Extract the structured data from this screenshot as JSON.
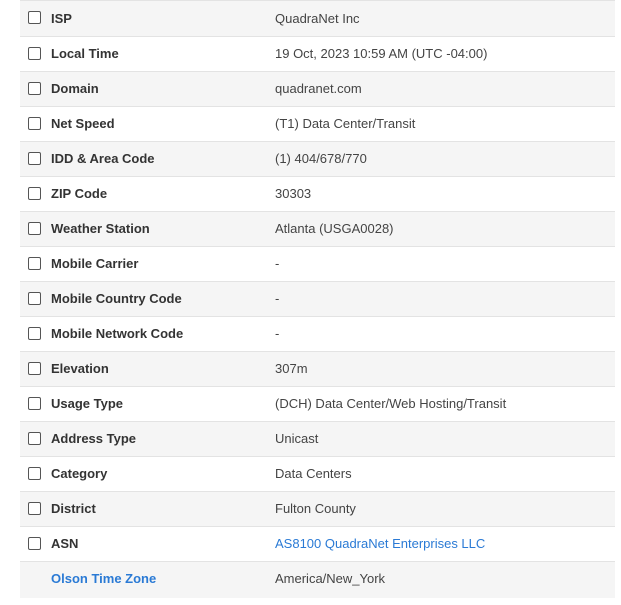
{
  "rows": [
    {
      "label": "ISP",
      "value": "QuadraNet Inc"
    },
    {
      "label": "Local Time",
      "value": "19 Oct, 2023 10:59 AM (UTC -04:00)"
    },
    {
      "label": "Domain",
      "value": "quadranet.com"
    },
    {
      "label": "Net Speed",
      "value": "(T1) Data Center/Transit"
    },
    {
      "label": "IDD & Area Code",
      "value": "(1) 404/678/770"
    },
    {
      "label": "ZIP Code",
      "value": "30303"
    },
    {
      "label": "Weather Station",
      "value": "Atlanta (USGA0028)"
    },
    {
      "label": "Mobile Carrier",
      "value": "-"
    },
    {
      "label": "Mobile Country Code",
      "value": "-"
    },
    {
      "label": "Mobile Network Code",
      "value": "-"
    },
    {
      "label": "Elevation",
      "value": "307m"
    },
    {
      "label": "Usage Type",
      "value": "(DCH) Data Center/Web Hosting/Transit"
    },
    {
      "label": "Address Type",
      "value": "Unicast"
    },
    {
      "label": "Category",
      "value": "Data Centers"
    },
    {
      "label": "District",
      "value": "Fulton County"
    },
    {
      "label": "ASN",
      "value": "AS8100 QuadraNet Enterprises LLC"
    },
    {
      "label": "Olson Time Zone",
      "value": "America/New_York"
    }
  ],
  "colors": {
    "link": "#2a7ad5",
    "label": "#333333",
    "value": "#444444",
    "stripe": "#f5f5f5",
    "border": "#e3e3e3"
  }
}
